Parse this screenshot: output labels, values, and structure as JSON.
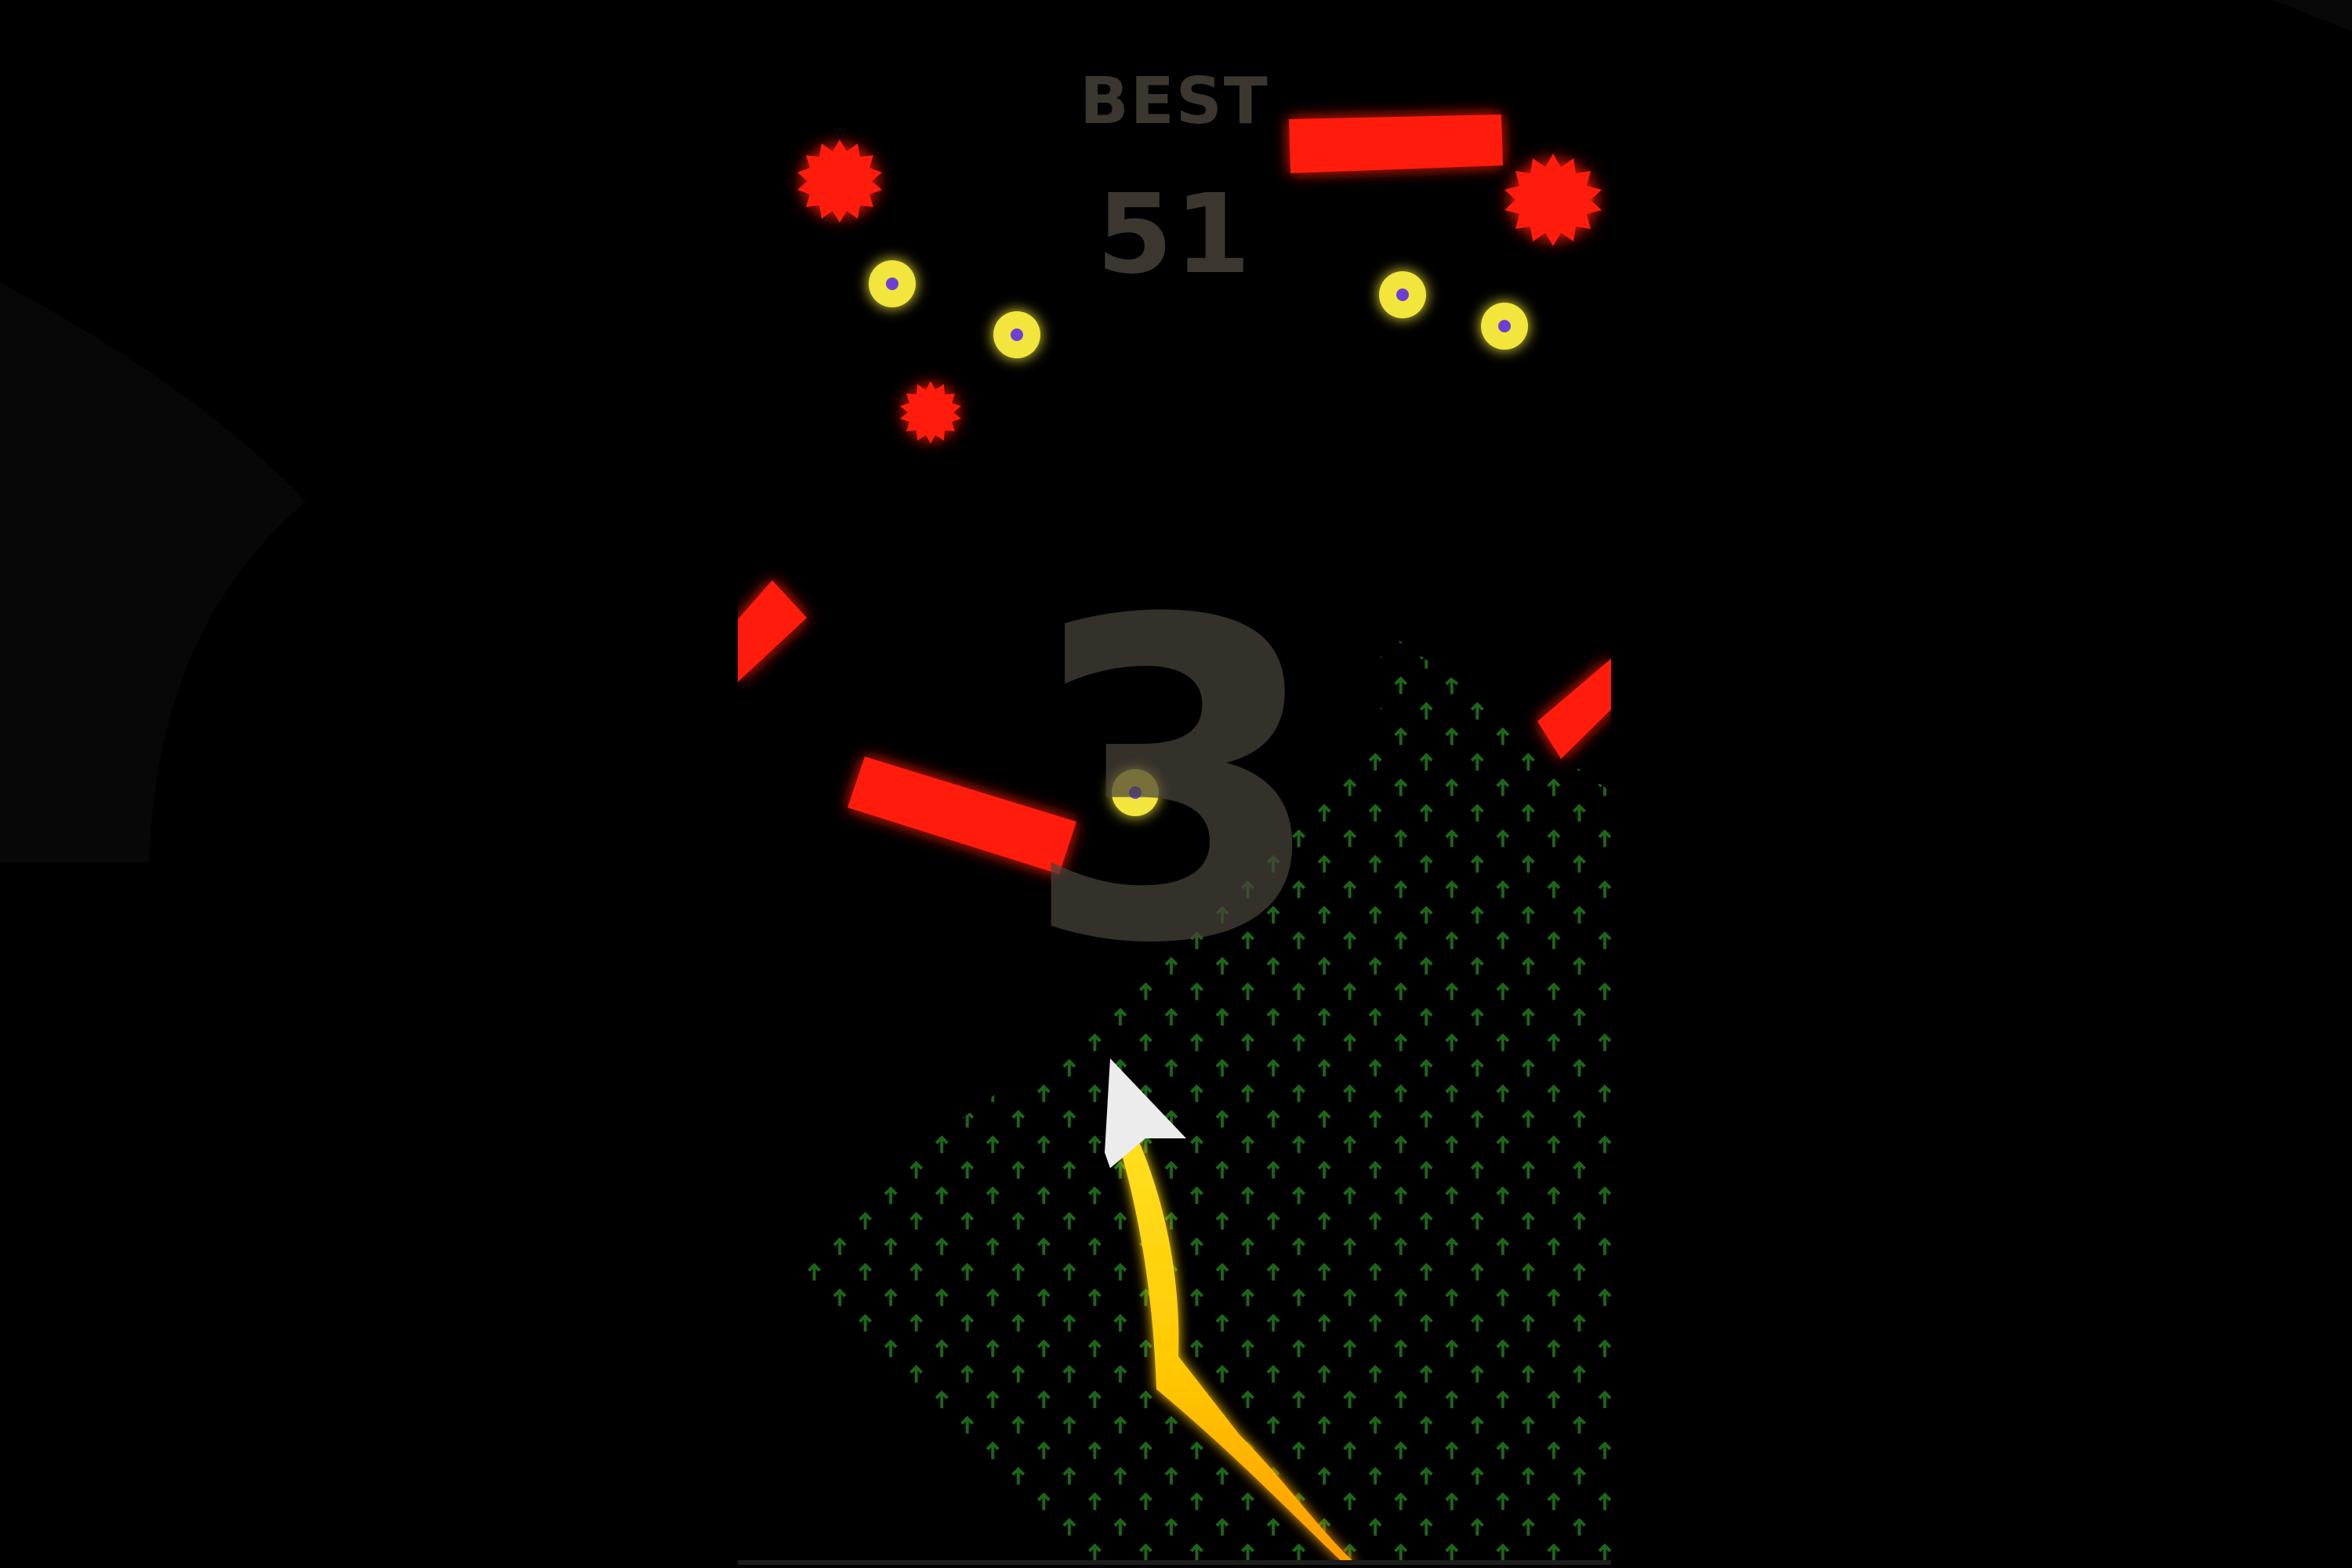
{
  "hud": {
    "best_label": "BEST",
    "best_score": "51",
    "countdown": "3"
  },
  "colors": {
    "background": "#000000",
    "obstacle": "#ff1a0a",
    "coin_ring": "#f2e53a",
    "coin_center": "#6b3fd6",
    "arrow_pattern": "#1f6b1a",
    "player": "#ececec",
    "trail_top": "#ffe020",
    "trail_bottom": "#ff9a00",
    "hud_text": "#3b3630"
  },
  "entities": {
    "player": "arrow-ship",
    "trail": "flame-trail",
    "hazards": [
      "spiked-ball",
      "spiked-ball",
      "spiked-ball",
      "red-bar",
      "red-bar",
      "red-bar",
      "red-bar"
    ],
    "pickups": [
      "coin",
      "coin",
      "coin",
      "coin",
      "coin"
    ]
  }
}
